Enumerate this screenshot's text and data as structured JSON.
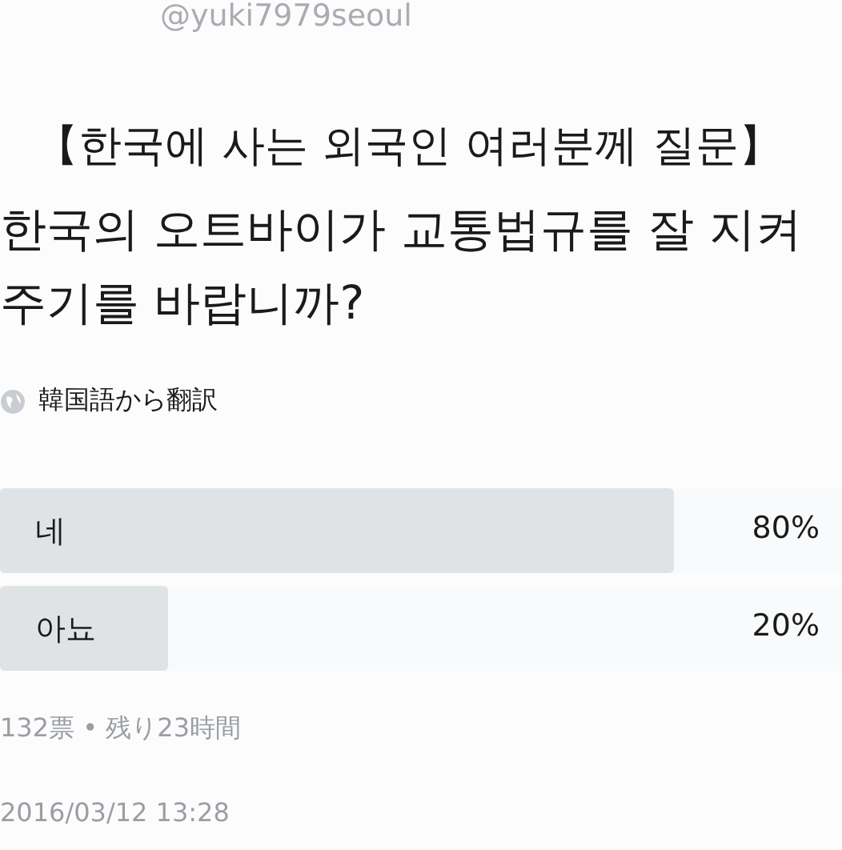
{
  "handle": "@yuki7979seoul",
  "tweet": {
    "title": "【한국에 사는 외국인 여러분께 질문】",
    "question": "한국의 오트바이가 교통법규를 잘 지켜 주기를 바랍니까?",
    "translate": "韓国語から翻訳"
  },
  "poll": {
    "options": [
      {
        "label": "네",
        "percent": "80%",
        "level": 0.8
      },
      {
        "label": "아뇨",
        "percent": "20%",
        "level": 0.2
      }
    ],
    "summary": "132票 • 残り23時間"
  },
  "timestamp": "2016/03/12 13:28"
}
